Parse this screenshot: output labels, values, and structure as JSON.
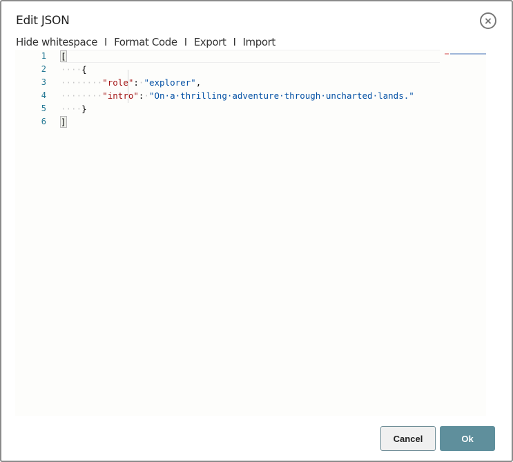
{
  "dialog": {
    "title": "Edit JSON",
    "close_icon": "circle-x-icon"
  },
  "toolbar": {
    "hide_whitespace": "Hide whitespace",
    "format_code": "Format Code",
    "export": "Export",
    "import": "Import",
    "separator": "I"
  },
  "editor": {
    "line_numbers": [
      "1",
      "2",
      "3",
      "4",
      "5",
      "6"
    ],
    "lines": {
      "l1": "[",
      "l2_ws": "····",
      "l2": "{",
      "l3_ws": "········",
      "l3_key": "\"role\"",
      "l3_colon": ":",
      "l3_ws2": "·",
      "l3_val": "\"explorer\"",
      "l3_end": ",",
      "l4_ws": "········",
      "l4_key": "\"intro\"",
      "l4_colon": ":",
      "l4_ws2": "·",
      "l4_val": "\"On·a·thrilling·adventure·through·uncharted·lands.\"",
      "l5_ws": "····",
      "l5": "}",
      "l6": "]"
    },
    "colors": {
      "key": "#a31515",
      "string": "#0451a5",
      "line_number": "#237893"
    }
  },
  "footer": {
    "cancel": "Cancel",
    "ok": "Ok",
    "ok_color": "#5f8f9c"
  }
}
